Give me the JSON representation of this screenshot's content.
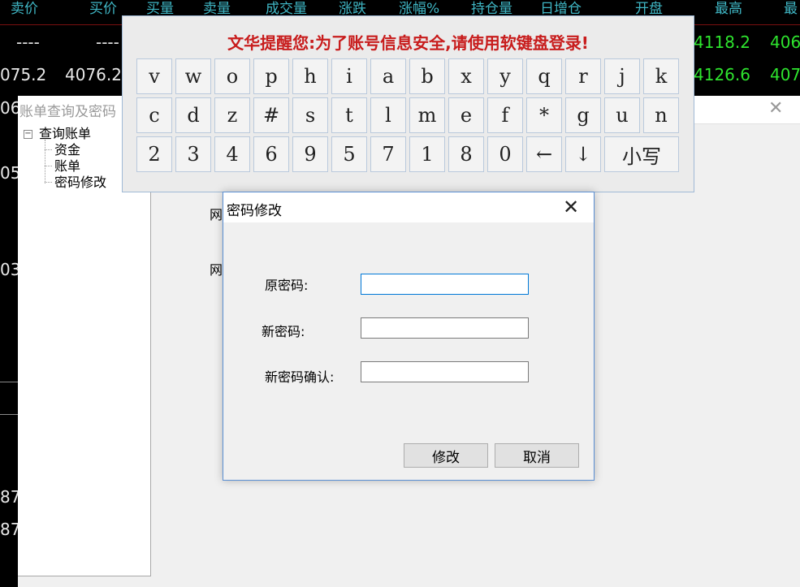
{
  "board": {
    "headers": [
      "卖价",
      "买价",
      "买量",
      "卖量",
      "成交量",
      "涨跌",
      "涨幅%",
      "持仓量",
      "日增仓",
      "开盘",
      "最高",
      "最"
    ],
    "row1": [
      "----",
      "----",
      "4118.2",
      "406"
    ],
    "row2": [
      "075.2",
      "4076.2",
      "4126.6",
      "407"
    ],
    "left_values": [
      "06",
      "05",
      "03",
      "87",
      "87"
    ],
    "colors": {
      "header": "#3fb6c4",
      "price_up": "#2ee32e",
      "neutral": "#e8e8e8"
    }
  },
  "account_window": {
    "title": "账单查询及密码",
    "close_icon": "close-icon",
    "tree": {
      "root": "查询账单",
      "children": [
        "资金",
        "账单",
        "密码修改"
      ]
    },
    "side_labels": [
      "网",
      "网"
    ]
  },
  "keyboard": {
    "warning": "文华提醒您:为了账号信息安全,请使用软键盘登录!",
    "rows": [
      [
        "v",
        "w",
        "o",
        "p",
        "h",
        "i",
        "a",
        "b",
        "x",
        "y",
        "q",
        "r",
        "j",
        "k"
      ],
      [
        "c",
        "d",
        "z",
        "#",
        "s",
        "t",
        "l",
        "m",
        "e",
        "f",
        "*",
        "g",
        "u",
        "n"
      ],
      [
        "2",
        "3",
        "4",
        "6",
        "9",
        "5",
        "7",
        "1",
        "8",
        "0",
        "←",
        "↓",
        "小写"
      ]
    ]
  },
  "dialog": {
    "title": "密码修改",
    "close_icon": "close-icon",
    "fields": [
      {
        "label": "原密码:",
        "value": ""
      },
      {
        "label": "新密码:",
        "value": ""
      },
      {
        "label": "新密码确认:",
        "value": ""
      }
    ],
    "ok_label": "修改",
    "cancel_label": "取消"
  }
}
